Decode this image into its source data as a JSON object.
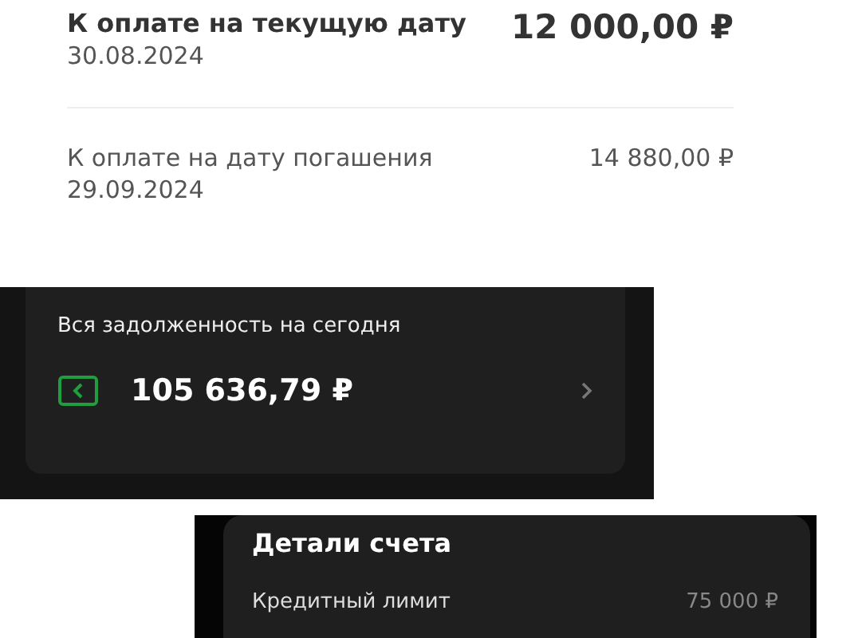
{
  "payments": [
    {
      "kind": "primary",
      "label": "К оплате на текущую дату",
      "date": "30.08.2024",
      "amount": "12 000,00 ₽"
    },
    {
      "kind": "secondary",
      "label": "К оплате на дату погашения",
      "date": "29.09.2024",
      "amount": "14 880,00 ₽"
    }
  ],
  "debt": {
    "title": "Вся задолженность на сегодня",
    "amount": "105 636,79 ₽"
  },
  "account_details": {
    "title": "Детали счета",
    "rows": [
      {
        "label": "Кредитный лимит",
        "value": "75 000 ₽"
      }
    ]
  }
}
